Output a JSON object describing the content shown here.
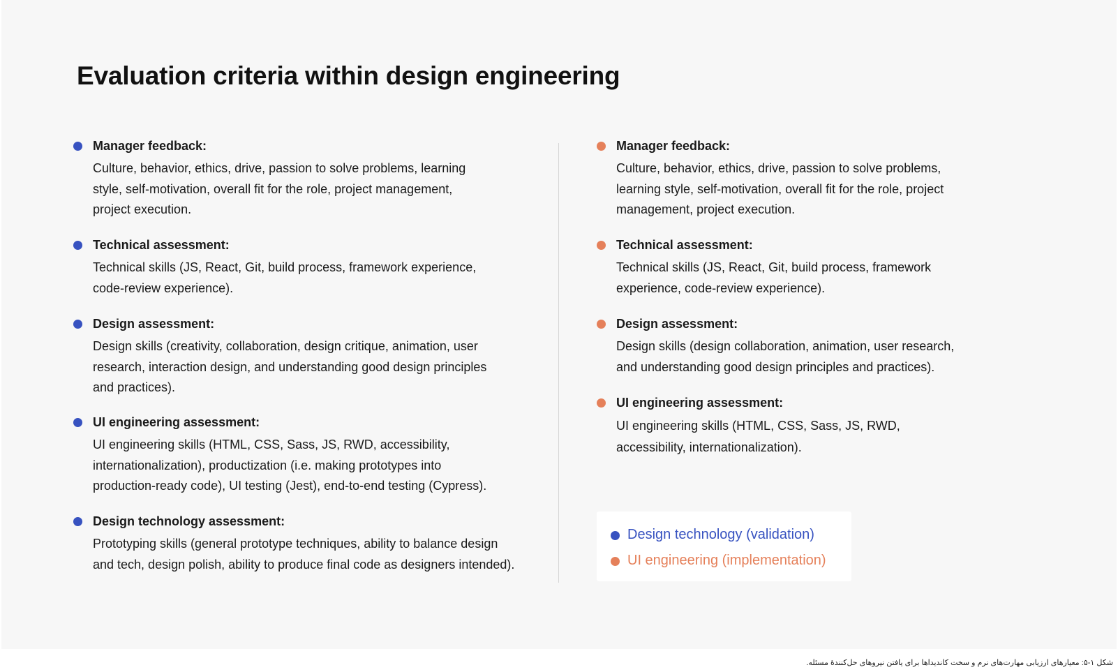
{
  "slide": {
    "title": "Evaluation criteria within design engineering"
  },
  "left_column": [
    {
      "heading": "Manager feedback:",
      "lines": [
        "Culture, behavior, ethics, drive, passion to solve problems, learning",
        "style, self-motivation, overall fit for the role, project management,",
        "project execution."
      ]
    },
    {
      "heading": "Technical assessment:",
      "lines": [
        "Technical skills (JS, React, Git, build process, framework experience,",
        "code-review experience)."
      ]
    },
    {
      "heading": "Design assessment:",
      "lines": [
        "Design skills (creativity, collaboration, design critique, animation, user",
        "research, interaction design, and understanding good design principles",
        "and practices)."
      ]
    },
    {
      "heading": "UI engineering assessment:",
      "lines": [
        "UI engineering skills (HTML, CSS, Sass, JS, RWD, accessibility,",
        "internationalization), productization (i.e. making prototypes into",
        "production-ready code), UI testing (Jest), end-to-end testing (Cypress)."
      ]
    },
    {
      "heading": "Design technology assessment:",
      "lines": [
        "Prototyping skills (general prototype techniques, ability to balance design",
        "and tech, design polish, ability to produce final code as designers intended)."
      ]
    }
  ],
  "right_column": [
    {
      "heading": "Manager feedback:",
      "lines": [
        "Culture, behavior, ethics, drive, passion to solve problems,",
        "learning style, self-motivation, overall fit for the role, project",
        "management, project execution."
      ]
    },
    {
      "heading": "Technical assessment:",
      "lines": [
        "Technical skills (JS, React, Git, build process, framework",
        "experience, code-review experience)."
      ]
    },
    {
      "heading": "Design assessment:",
      "lines": [
        "Design skills (design collaboration, animation, user research,",
        "and understanding good design principles and practices)."
      ]
    },
    {
      "heading": "UI engineering assessment:",
      "lines": [
        "UI engineering skills (HTML, CSS, Sass, JS, RWD,",
        "accessibility, internationalization)."
      ]
    }
  ],
  "legend": {
    "blue_label": "Design technology (validation)",
    "orange_label": "UI engineering (implementation)"
  },
  "colors": {
    "blue": "#3752c0",
    "orange": "#e5805a"
  },
  "caption": "شکل ۱-۵: معیارهای ارزیابی مهارت‌های نرم و سخت کاندیداها برای یافتن نیروهای حل‌کنندهٔ مسئله."
}
